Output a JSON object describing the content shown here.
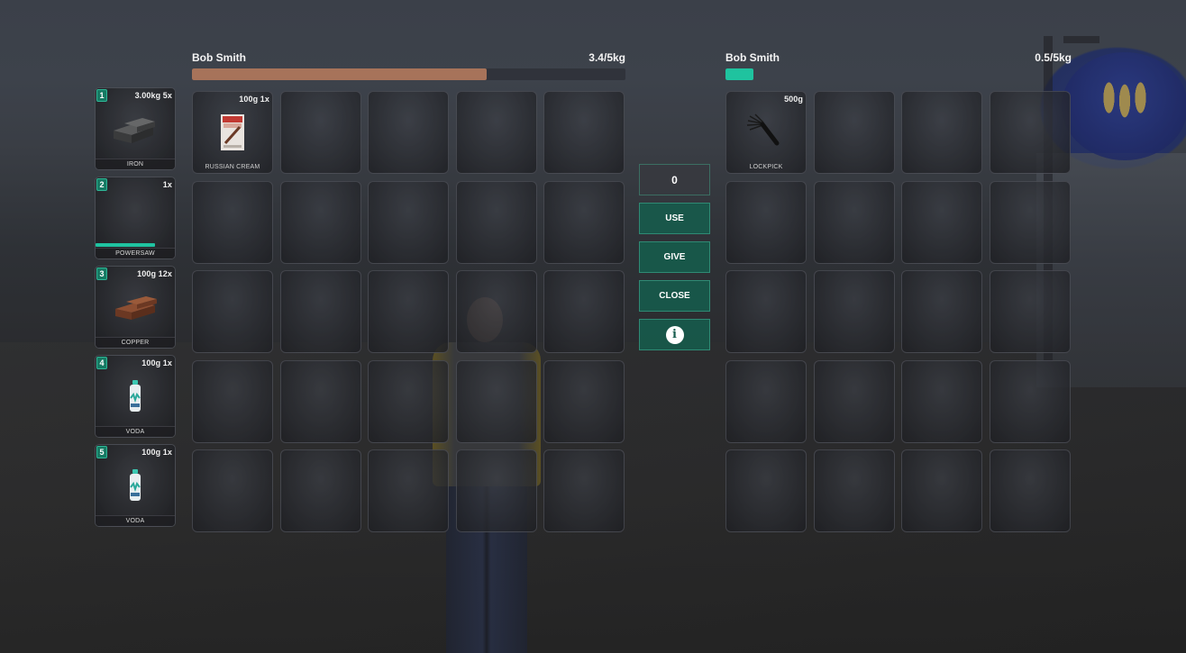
{
  "hotbar": [
    {
      "slot": "1",
      "info": "3.00kg 5x",
      "label": "IRON",
      "icon": "iron-ingot-icon"
    },
    {
      "slot": "2",
      "info": "1x",
      "label": "POWERSAW",
      "icon": "powersaw-icon",
      "durability": 0.75
    },
    {
      "slot": "3",
      "info": "100g 12x",
      "label": "COPPER",
      "icon": "copper-bars-icon"
    },
    {
      "slot": "4",
      "info": "100g 1x",
      "label": "VODA",
      "icon": "water-bottle-icon"
    },
    {
      "slot": "5",
      "info": "100g 1x",
      "label": "VODA",
      "icon": "water-bottle-icon"
    }
  ],
  "left_inventory": {
    "owner": "Bob Smith",
    "weight_text": "3.4/5kg",
    "weight_fraction": 0.68,
    "bar_color": "#a7735a",
    "items": [
      {
        "index": 0,
        "info": "100g 1x",
        "label": "RUSSIAN CREAM",
        "icon": "russian-cream-pack-icon"
      }
    ]
  },
  "right_inventory": {
    "owner": "Bob Smith",
    "weight_text": "0.5/5kg",
    "weight_fraction": 0.08,
    "bar_color": "#1fc39f",
    "items": [
      {
        "index": 0,
        "info": "500g",
        "label": "LOCKPICK",
        "icon": "lockpick-icon"
      }
    ]
  },
  "actions": {
    "amount_value": "0",
    "use_label": "USE",
    "give_label": "GIVE",
    "close_label": "CLOSE",
    "info_icon": "i"
  }
}
